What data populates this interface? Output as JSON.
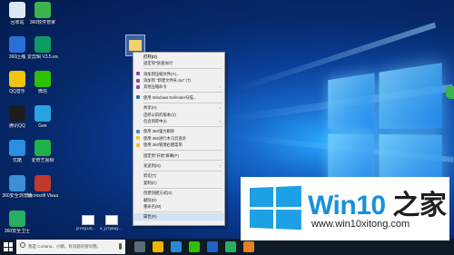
{
  "desktop": {
    "icons": [
      {
        "label": "回收站",
        "color": "#dfe8f5"
      },
      {
        "label": "360软件管家",
        "color": "#3cb44b"
      },
      {
        "label": "360压缩",
        "color": "#2a6fd6"
      },
      {
        "label": "爱剪辑 V3.5.exe...",
        "color": "#0f9a63"
      },
      {
        "label": "QQ音乐",
        "color": "#f1c40f"
      },
      {
        "label": "微信",
        "color": "#2dc100"
      },
      {
        "label": "腾讯QQ",
        "color": "#1d1d1d"
      },
      {
        "label": "Gee",
        "color": "#29a3e0"
      },
      {
        "label": "优酷",
        "color": "#2b8fe0"
      },
      {
        "label": "爱奇艺视频",
        "color": "#1fb04a"
      },
      {
        "label": "360安全浏览器",
        "color": "#3c8ed6"
      },
      {
        "label": "Microsoft Visual C++...",
        "color": "#c0392b"
      },
      {
        "label": "360安全卫士",
        "color": "#27ae60"
      }
    ],
    "thumbnails": [
      {
        "label": "[27G]LUS..."
      },
      {
        "label": "X_[17]XNQ..."
      }
    ]
  },
  "context_menu": {
    "items": [
      {
        "label": "打开(O)",
        "bold": true
      },
      {
        "label": "固定到\"快速访问\""
      },
      {
        "sep": true
      },
      {
        "label": "添加到压缩文件(A)...",
        "icon": "#8e44ad"
      },
      {
        "label": "添加到 \"新建文件夹.zip\" (T)",
        "icon": "#8e44ad"
      },
      {
        "label": "其他压缩命令",
        "icon": "#8e44ad",
        "submenu": true
      },
      {
        "sep": true
      },
      {
        "label": "使用 Windows Defender扫描...",
        "icon": "#2c6fbf"
      },
      {
        "sep": true
      },
      {
        "label": "共享(H)",
        "submenu": true
      },
      {
        "label": "还原以前的版本(V)"
      },
      {
        "label": "包含到库中(I)",
        "submenu": true
      },
      {
        "sep": true
      },
      {
        "label": "使用 360强力删除",
        "icon": "#3c8ed6"
      },
      {
        "label": "使用 360进行木马云查杀",
        "icon": "#f1c40f"
      },
      {
        "label": "使用 360管理右键菜单",
        "icon": "#f1c40f"
      },
      {
        "sep": true
      },
      {
        "label": "固定到\"开始\"屏幕(P)"
      },
      {
        "sep": true
      },
      {
        "label": "发送到(N)",
        "submenu": true
      },
      {
        "sep": true
      },
      {
        "label": "剪切(T)"
      },
      {
        "label": "复制(C)"
      },
      {
        "sep": true
      },
      {
        "label": "创建快捷方式(S)"
      },
      {
        "label": "删除(D)"
      },
      {
        "label": "重命名(M)"
      },
      {
        "sep": true
      },
      {
        "label": "属性(R)",
        "highlight": true
      }
    ]
  },
  "taskbar": {
    "search_placeholder": "我是 Cortana，小娜。有问题尽管问我。",
    "apps": [
      "#5b6b7c",
      "#f0b400",
      "#2b88d8",
      "#2dc100",
      "#1e63c4",
      "#27ae60",
      "#e67e22"
    ]
  },
  "brand": {
    "name_part1": "Win10",
    "name_part2": " 之家",
    "url": "www.win10xitong.com"
  }
}
